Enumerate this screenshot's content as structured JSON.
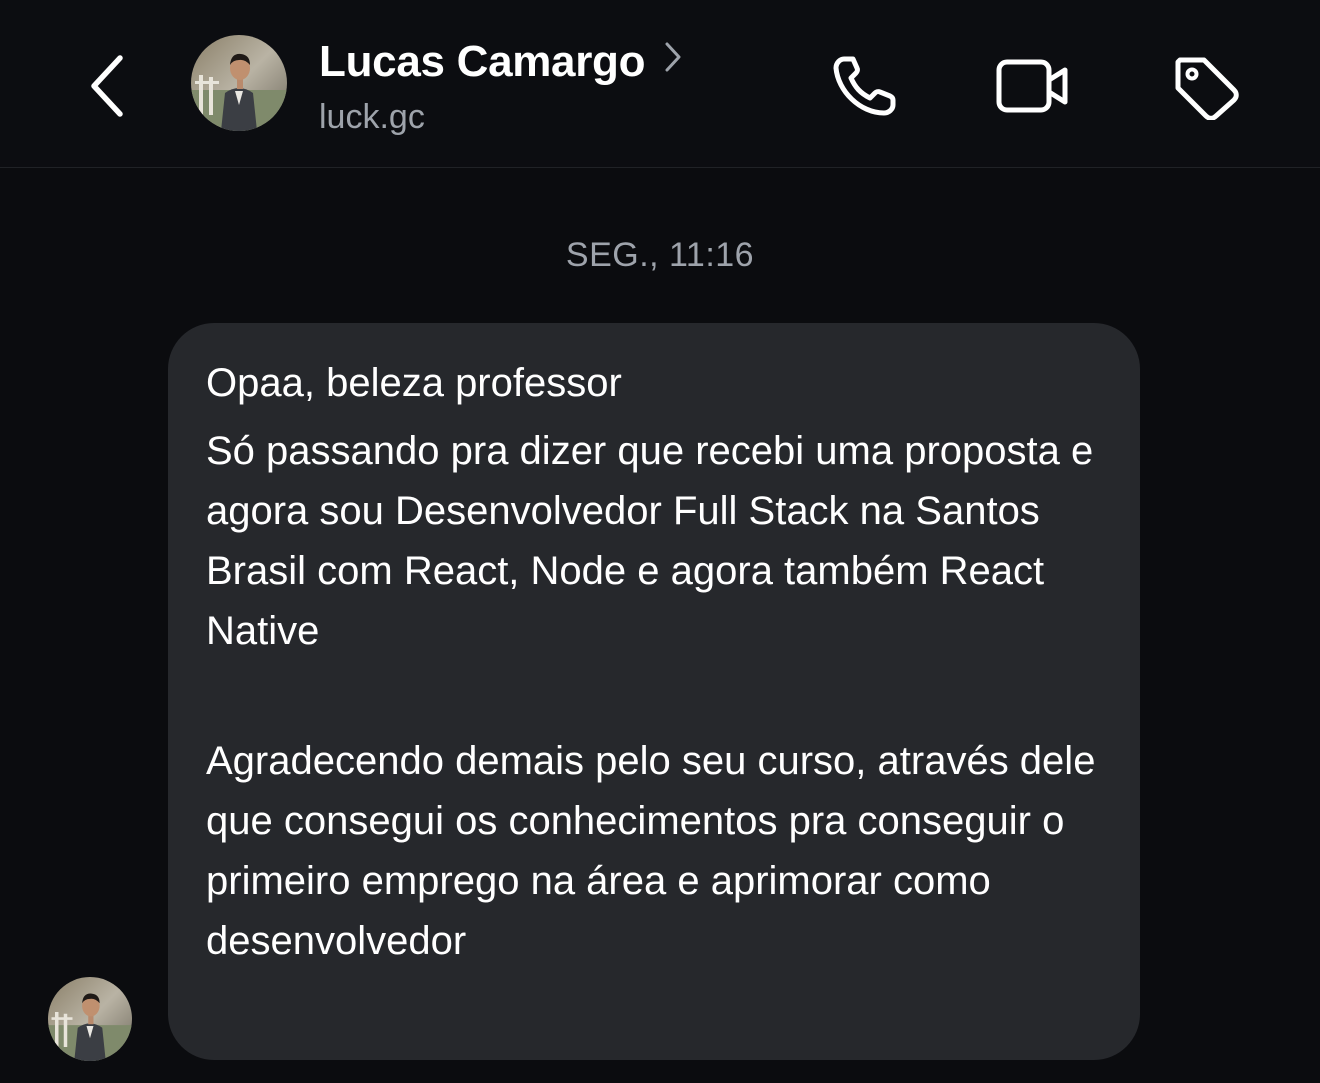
{
  "header": {
    "contact_name": "Lucas Camargo",
    "username": "luck.gc",
    "icons": {
      "back": "chevron-left-icon",
      "profile": "chevron-right-icon",
      "call": "phone-icon",
      "video": "video-camera-icon",
      "tag": "tag-icon"
    }
  },
  "thread": {
    "timestamp": "SEG., 11:16",
    "message": {
      "line1": "Opaa, beleza professor",
      "line2": "Só passando pra dizer que recebi uma proposta e agora sou Desenvolvedor Full Stack na Santos Brasil com React, Node e agora também React Native",
      "line3": "Agradecendo demais pelo seu curso, através dele que consegui os conhecimentos pra conseguir o primeiro emprego na área e aprimorar como desenvolvedor"
    }
  },
  "colors": {
    "background": "#0b0c0f",
    "bubble": "#26282c",
    "secondary_text": "#9ea3ab",
    "primary_text": "#ffffff"
  }
}
